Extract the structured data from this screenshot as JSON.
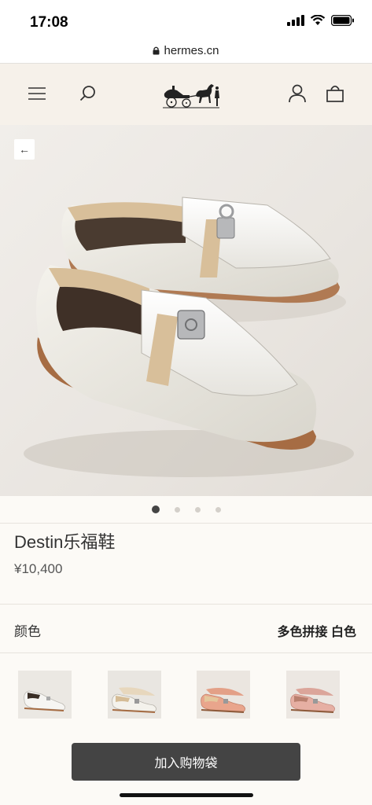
{
  "status_bar": {
    "time": "17:08"
  },
  "browser": {
    "url": "hermes.cn"
  },
  "header": {
    "menu_icon": "menu-icon",
    "search_icon": "search-icon",
    "logo": "hermes-carriage-logo",
    "account_icon": "user-icon",
    "bag_icon": "shopping-bag-icon"
  },
  "gallery": {
    "back_glyph": "←",
    "image_count": 4,
    "active_index": 0
  },
  "product": {
    "name": "Destin乐福鞋",
    "price": "¥10,400"
  },
  "color": {
    "label": "颜色",
    "value": "多色拼接 白色"
  },
  "variants": [
    {
      "name": "white"
    },
    {
      "name": "white-beige"
    },
    {
      "name": "pink-coral"
    },
    {
      "name": "pink-rose"
    }
  ],
  "cta": {
    "add_to_bag": "加入购物袋"
  },
  "colors": {
    "cta_bg": "#444444",
    "header_bg": "#f6f1ea",
    "page_bg": "#fcfaf6"
  }
}
